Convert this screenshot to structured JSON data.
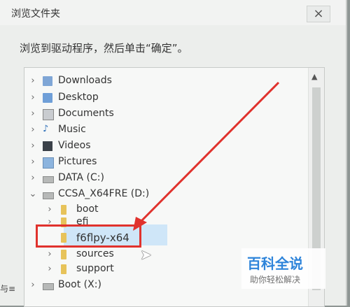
{
  "dialog": {
    "title": "浏览文件夹",
    "close_label": "×",
    "instruction": "浏览到驱动程序，然后单击“确定”。"
  },
  "tree": {
    "items": [
      {
        "label": "Downloads",
        "chevron": "›",
        "icon": "download-icon"
      },
      {
        "label": "Desktop",
        "chevron": "›",
        "icon": "folder-icon"
      },
      {
        "label": "Documents",
        "chevron": "›",
        "icon": "document-icon"
      },
      {
        "label": "Music",
        "chevron": "›",
        "icon": "music-icon"
      },
      {
        "label": "Videos",
        "chevron": "›",
        "icon": "video-icon"
      },
      {
        "label": "Pictures",
        "chevron": "›",
        "icon": "picture-icon"
      },
      {
        "label": "DATA (C:)",
        "chevron": "›",
        "icon": "drive-icon"
      },
      {
        "label": "CCSA_X64FRE (D:)",
        "chevron": "⌄",
        "icon": "drive-icon"
      },
      {
        "label": "boot",
        "chevron": "›",
        "icon": "folder-icon"
      },
      {
        "label": "efi",
        "chevron": "›",
        "icon": "folder-icon"
      },
      {
        "label": "f6flpy-x64",
        "chevron": "",
        "icon": "folder-icon"
      },
      {
        "label": "sources",
        "chevron": "›",
        "icon": "folder-icon"
      },
      {
        "label": "support",
        "chevron": "›",
        "icon": "folder-icon"
      },
      {
        "label": "Boot (X:)",
        "chevron": "›",
        "icon": "drive-icon"
      }
    ]
  },
  "side_text": "与≡",
  "watermark": {
    "title": "百科全说",
    "subtitle": "助你轻松解决"
  },
  "colors": {
    "highlight": "#e0322d",
    "selection": "#cfe6f8",
    "folder": "#e7c35a"
  }
}
